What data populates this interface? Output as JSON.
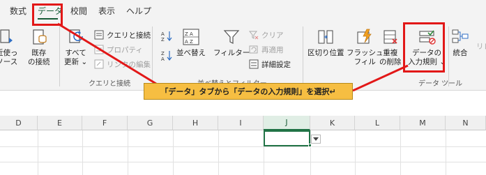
{
  "tabs": [
    {
      "label": "数式"
    },
    {
      "label": "データ"
    },
    {
      "label": "校閲"
    },
    {
      "label": "表示"
    },
    {
      "label": "ヘルプ"
    }
  ],
  "ribbon": {
    "get_data": {
      "line1": "近使っ",
      "line2": "ソース"
    },
    "existing_connections": {
      "line1": "既存",
      "line2": "の接続"
    },
    "refresh_all": {
      "line1": "すべて",
      "line2": "更新 ⌄"
    },
    "queries_connections": "クエリと接続",
    "properties": "プロパティ",
    "edit_links": "リンクの編集",
    "group_queries": "クエリと接続",
    "sort": "並べ替え",
    "filter": "フィルター",
    "clear": "クリア",
    "reapply": "再適用",
    "advanced": "詳細設定",
    "group_sort_filter": "並べ替えとフィルター",
    "text_to_columns": "区切り位置",
    "flash_fill": {
      "line1": "フラッシュ",
      "line2": "フィル"
    },
    "remove_duplicates": {
      "line1": "重複",
      "line2": "の削除"
    },
    "data_validation": {
      "line1": "データの",
      "line2": "入力規則 ⌄"
    },
    "consolidate": "統合",
    "relationships": "リレ",
    "group_data_tools": "データ ツール"
  },
  "callout": {
    "text": "「データ」タブから「データの入力規則」を選択↵"
  },
  "sheet": {
    "columns": [
      "D",
      "E",
      "F",
      "G",
      "H",
      "I",
      "J",
      "K",
      "L",
      "M",
      "N"
    ],
    "selected_column": "J"
  },
  "colors": {
    "accent": "#217346",
    "callout_bg": "#f6be42",
    "highlight": "#e21818"
  }
}
